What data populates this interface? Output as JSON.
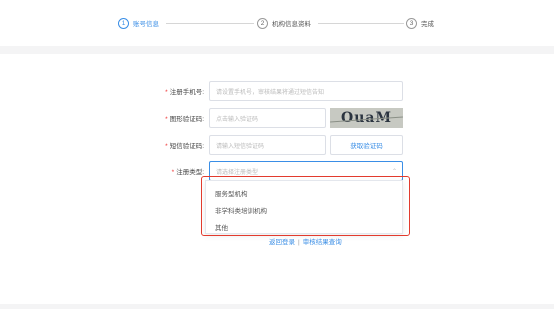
{
  "steps": [
    {
      "num": "1",
      "label": "账号信息",
      "active": true
    },
    {
      "num": "2",
      "label": "机构信息资料",
      "active": false
    },
    {
      "num": "3",
      "label": "完成",
      "active": false
    }
  ],
  "form": {
    "phone": {
      "label": "注册手机号:",
      "placeholder": "请设置手机号，审核结果将通过短信告知"
    },
    "captcha": {
      "label": "图形验证码:",
      "placeholder": "点击输入验证码",
      "image_text": "OuaM"
    },
    "sms": {
      "label": "短信验证码:",
      "placeholder": "请输入短信验证码",
      "button": "获取验证码"
    },
    "type": {
      "label": "注册类型:",
      "placeholder": "请选择注册类型"
    }
  },
  "dropdown_options": [
    "服务型机构",
    "非学科类培训机构",
    "其他"
  ],
  "links": {
    "back_login": "返回登录",
    "separator": "|",
    "audit_query": "审核结果查询"
  },
  "colors": {
    "accent": "#3a8ee6",
    "required": "#e33333",
    "highlight": "#e23b2e"
  }
}
